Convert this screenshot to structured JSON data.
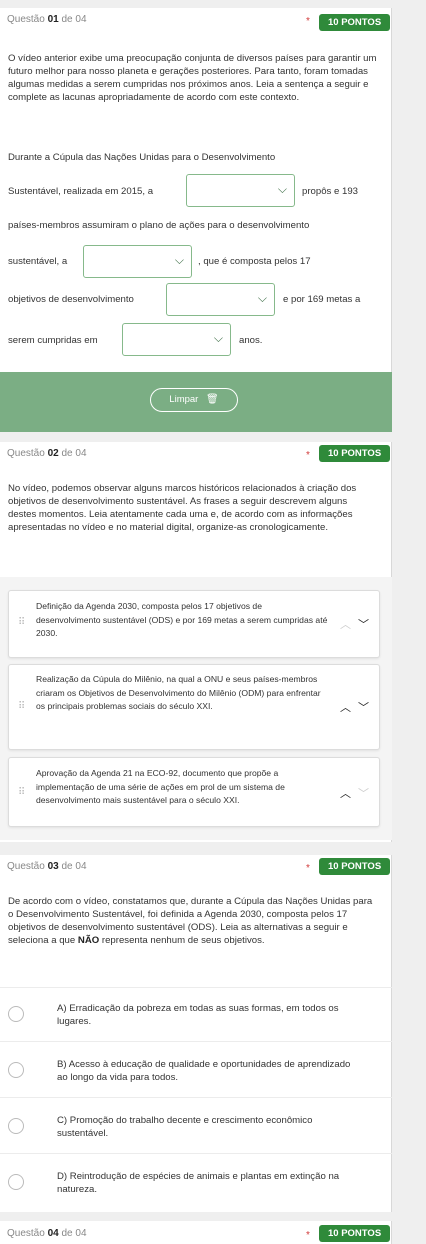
{
  "q1": {
    "label": "Questão",
    "number": "01",
    "of": "de 04",
    "star": "*",
    "points": "10 PONTOS",
    "intro": "O vídeo anterior exibe uma preocupação conjunta de diversos países para garantir um futuro melhor para nosso planeta e gerações posteriores. Para tanto, foram tomadas algumas medidas a serem cumpridas nos próximos anos. Leia a sentença a seguir e complete as lacunas apropriadamente de acordo com este contexto.",
    "s1": "Durante a Cúpula das Nações Unidas para o Desenvolvimento",
    "s2a": "Sustentável, realizada em 2015, a",
    "s2b": "propôs e 193",
    "s3": "países-membros assumiram o plano de ações para o desenvolvimento",
    "s4a": "sustentável, a",
    "s4b": ", que é composta pelos 17",
    "s5a": "objetivos de desenvolvimento",
    "s5b": "e por 169 metas a",
    "s6a": "serem cumpridas em",
    "s6b": "anos.",
    "chevron": "⌵",
    "clear_label": "Limpar",
    "trash": "🗑"
  },
  "q2": {
    "label": "Questão",
    "number": "02",
    "of": "de 04",
    "star": "*",
    "points": "10 PONTOS",
    "intro": "No vídeo, podemos observar alguns marcos históricos relacionados à criação dos objetivos de desenvolvimento sustentável. As frases a seguir descrevem alguns destes momentos. Leia atentamente cada uma e, de acordo com as informações apresentadas no vídeo e no material digital, organize-as cronologicamente.",
    "items": [
      {
        "text": "Definição da Agenda 2030, composta pelos 17 objetivos de desenvolvimento sustentável (ODS) e por 169 metas a serem cumpridas até 2030."
      },
      {
        "text": "Realização da Cúpula do Milênio, na qual a ONU e seus países-membros criaram os Objetivos de Desenvolvimento do Milênio (ODM) para enfrentar os principais problemas sociais do século XXI."
      },
      {
        "text": "Aprovação da Agenda 21 na ECO-92, documento que propõe a implementação de uma série de ações em prol de um sistema de desenvolvimento mais sustentável para o século XXI."
      }
    ],
    "grip": "⠿",
    "up": "︿",
    "down": "﹀"
  },
  "q3": {
    "label": "Questão",
    "number": "03",
    "of": "de 04",
    "star": "*",
    "points": "10 PONTOS",
    "intro": "De acordo com o vídeo, constatamos que, durante a Cúpula das Nações Unidas para o Desenvolvimento Sustentável, foi definida a Agenda 2030, composta pelos 17 objetivos de desenvolvimento sustentável (ODS). Leia as alternativas a seguir e seleciona a que",
    "intro_bold": "NÃO",
    "intro_end": "representa nenhum de seus objetivos.",
    "options": [
      {
        "text": "A) Erradicação da pobreza em todas as suas formas, em todos os lugares."
      },
      {
        "text": "B) Acesso à educação de qualidade e oportunidades de aprendizado ao longo da vida para todos."
      },
      {
        "text": "C) Promoção do trabalho decente e crescimento econômico sustentável."
      },
      {
        "text": "D) Reintrodução de espécies de animais e plantas em extinção na natureza."
      }
    ]
  },
  "q4": {
    "label": "Questão",
    "number": "04",
    "of": "de 04",
    "star": "*",
    "points": "10 PONTOS"
  }
}
